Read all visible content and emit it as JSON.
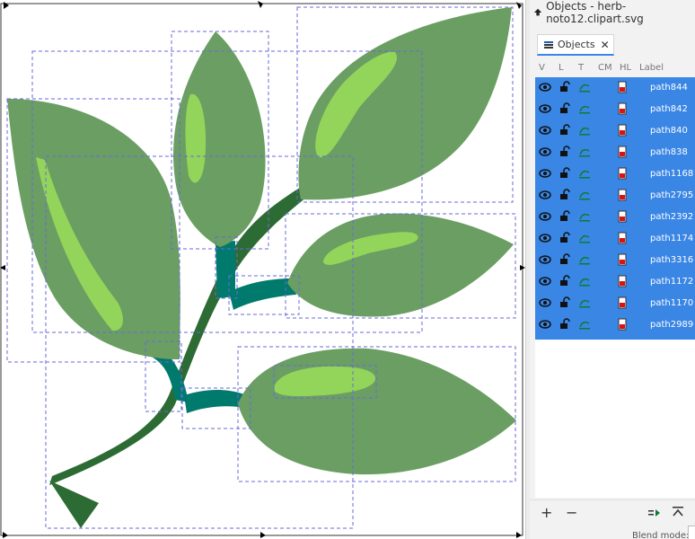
{
  "window": {
    "title": "Objects - herb-noto12.clipart.svg",
    "app_icon": "inkscape-logo-icon"
  },
  "objects_panel": {
    "tab_label": "Objects",
    "tab_icon": "objects-panel-icon",
    "tab_close_glyph": "✕",
    "columns": [
      "V",
      "L",
      "T",
      "CM",
      "HL",
      "Label"
    ],
    "row_icons": {
      "visibility": "eye-icon",
      "lock": "unlocked-padlock-icon",
      "type": "path-type-icon",
      "highlight": "highlight-color-icon"
    },
    "rows": [
      {
        "label": "path844"
      },
      {
        "label": "path842"
      },
      {
        "label": "path840"
      },
      {
        "label": "path838"
      },
      {
        "label": "path1168"
      },
      {
        "label": "path2795"
      },
      {
        "label": "path2392"
      },
      {
        "label": "path1174"
      },
      {
        "label": "path3316"
      },
      {
        "label": "path1172"
      },
      {
        "label": "path1170"
      },
      {
        "label": "path2989"
      }
    ],
    "selection_color": "#3a86e5"
  },
  "bottom_bar": {
    "add_glyph": "+",
    "remove_glyph": "−",
    "move_to_layer_icon": "move-to-layer-icon",
    "collapse_icon": "collapse-up-icon",
    "blend_mode_label": "Blend mode:"
  },
  "canvas": {
    "drawing": "herb clipart",
    "colors": {
      "leaf": "#6a9e62",
      "leaf_highlight": "#93d45a",
      "stem_dark": "#2d6b34",
      "stem_teal": "#007a6c",
      "bbox_dash": "#6a6adb",
      "page_border": "#333333"
    }
  }
}
